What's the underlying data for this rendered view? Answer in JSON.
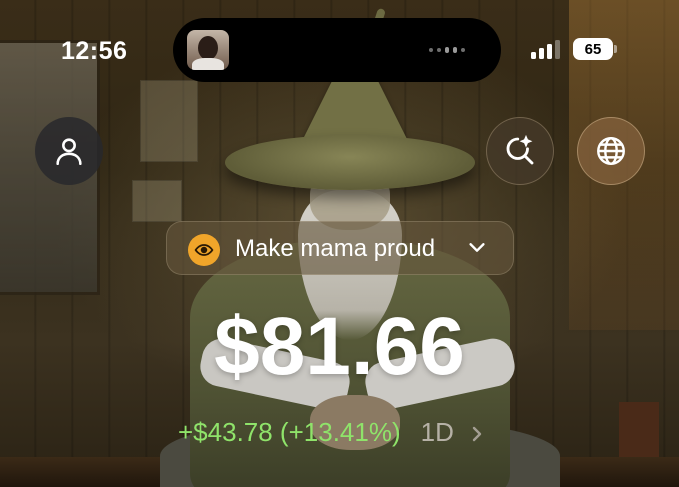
{
  "status_bar": {
    "time": "12:56",
    "battery": "65"
  },
  "portfolio": {
    "name": "Make mama proud",
    "balance": "$81.66",
    "change": "+$43.78 (+13.41%)",
    "period": "1D"
  },
  "icons": {
    "profile": "person-icon",
    "search": "sparkle-search-icon",
    "globe": "globe-icon",
    "eye": "eye-icon",
    "chevron": "chevron-down-icon",
    "arrow": "chevron-right-icon"
  },
  "colors": {
    "positive_change": "#8fe36a",
    "eye_badge": "#f0a52a"
  }
}
